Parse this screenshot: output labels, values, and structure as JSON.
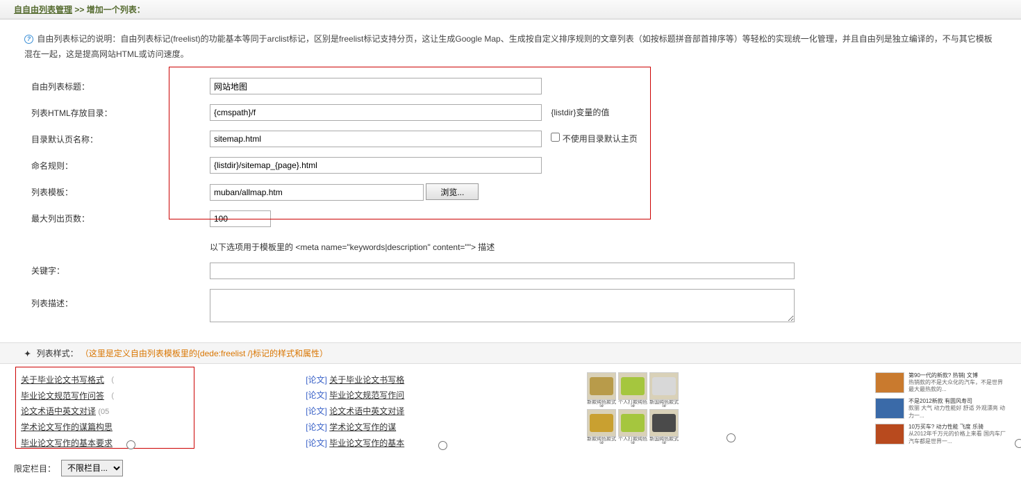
{
  "breadcrumb": {
    "link": "自自由列表管理",
    "sep": " >> ",
    "current": "增加一个列表："
  },
  "info": {
    "text": "自由列表标记的说明：自由列表标记(freelist)的功能基本等同于arclist标记，区别是freelist标记支持分页，这让生成Google Map、生成按自定义排序规则的文章列表（如按标题拼音部首排序等）等轻松的实现统一化管理，并且自由列是独立编译的，不与其它模板混在一起，这是提高网站HTML或访问速度。"
  },
  "form": {
    "title_label": "自由列表标题：",
    "title_value": "网站地图",
    "dir_label": "列表HTML存放目录：",
    "dir_value": "{cmspath}/f",
    "dir_hint": "{listdir}变量的值",
    "default_label": "目录默认页名称：",
    "default_value": "sitemap.html",
    "nodef_label": "不使用目录默认主页",
    "rule_label": "命名规则：",
    "rule_value": "{listdir}/sitemap_{page}.html",
    "tpl_label": "列表模板：",
    "tpl_value": "muban/allmap.htm",
    "browse": "浏览...",
    "max_label": "最大列出页数：",
    "max_value": "100",
    "meta_hint": "以下选项用于模板里的 <meta name=\"keywords|description\" content=\"\"> 描述",
    "kw_label": "关键字：",
    "kw_value": "",
    "desc_label": "列表描述：",
    "desc_value": ""
  },
  "section": {
    "chev": "⬩",
    "title": "列表样式：",
    "orange": "（这里是定义自由列表模板里的{dede:freelist /}标记的样式和属性）"
  },
  "styles": {
    "list1": [
      {
        "t": "关于毕业论文书写格式",
        "m": "（"
      },
      {
        "t": "毕业论文规范写作问答",
        "m": "（"
      },
      {
        "t": "论文术语中英文对译",
        "m": "(05"
      },
      {
        "t": "学术论文写作的谋篇构思",
        "m": ""
      },
      {
        "t": "毕业论文写作的基本要求",
        "m": ""
      }
    ],
    "list2": [
      {
        "tag": "[论文]",
        "t": "关于毕业论文书写格"
      },
      {
        "tag": "[论文]",
        "t": "毕业论文规范写作问"
      },
      {
        "tag": "[论文]",
        "t": "论文术语中英文对译"
      },
      {
        "tag": "[论文]",
        "t": "学术论文写作的谋"
      },
      {
        "tag": "[论文]",
        "t": "毕业论文写作的基本"
      }
    ],
    "thumbs": [
      "新款纯色款式 该",
      "个人打款纯色 该",
      "新国纯色款式 该",
      "新款纯色款式 该",
      "个人打款纯色 该",
      "新国纯色款式 该"
    ],
    "cars": [
      {
        "t": "第90一代的新款? 热销| 文博",
        "d": "热销款的不是大众化的汽车，不是世界最大最热款的..."
      },
      {
        "t": "不是2012新款 有圆风寿司",
        "d": "款丽 大气 动力性能好 舒适 外观漂亮 动力一..."
      },
      {
        "t": "10万买车? 动力性能 飞度 乐骑",
        "d": "从2012年千万元的价格上来看 国内车厂汽车都是世界一..."
      }
    ]
  },
  "bottom": {
    "label": "限定栏目：",
    "select": "不限栏目..."
  }
}
